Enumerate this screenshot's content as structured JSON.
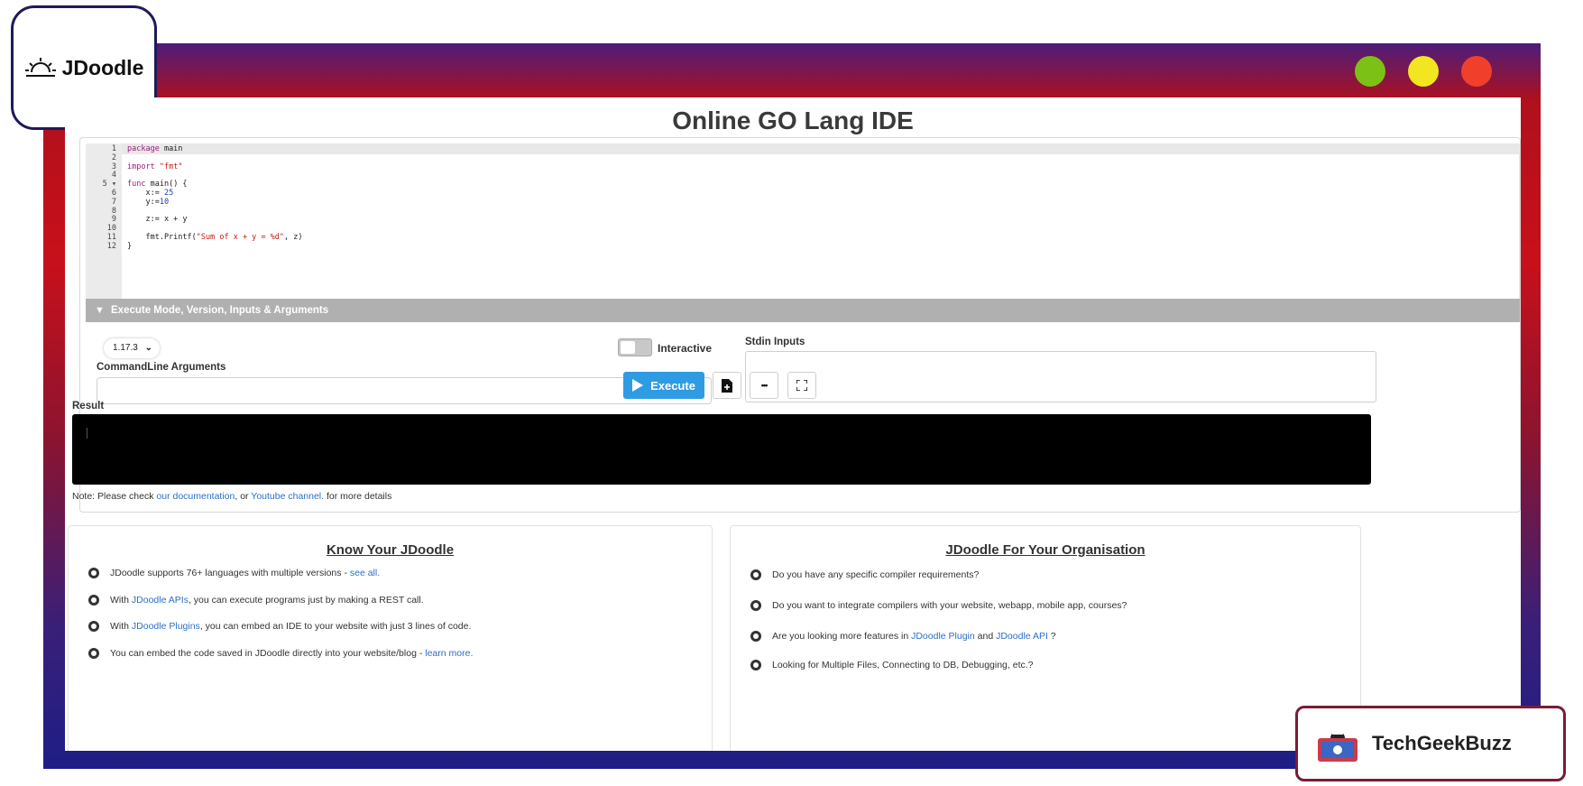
{
  "logo": {
    "text": "JDoodle",
    "icon": "sunrise-icon"
  },
  "window_controls": {
    "colors": [
      "#7cc115",
      "#f2e620",
      "#f0402b"
    ]
  },
  "page": {
    "title": "Online GO Lang IDE"
  },
  "editor": {
    "line_numbers": [
      "1",
      "2",
      "3",
      "4",
      "5",
      "6",
      "7",
      "8",
      "9",
      "10",
      "11",
      "12"
    ],
    "fold_marker": "▾",
    "code_lines": [
      "package main",
      "",
      "import \"fmt\"",
      "",
      "func main() {",
      "    x:= 25",
      "    y:=10",
      "",
      "    z:= x + y",
      "",
      "    fmt.Printf(\"Sum of x + y = %d\", z)",
      "}"
    ]
  },
  "execute_panel": {
    "header": "Execute Mode, Version, Inputs & Arguments",
    "version": "1.17.3",
    "interactive_label": "Interactive",
    "cmd_args_label": "CommandLine Arguments",
    "stdin_label": "Stdin Inputs"
  },
  "toolbar": {
    "execute_label": "Execute",
    "more_label": "•••"
  },
  "result": {
    "label": "Result"
  },
  "note": {
    "prefix": "Note: Please check ",
    "link1": "our documentation",
    "mid": ", or ",
    "link2": "Youtube channel.",
    "suffix": " for more details"
  },
  "cards": {
    "left": {
      "title": "Know Your JDoodle",
      "items": [
        {
          "text": "JDoodle supports 76+ languages with multiple versions - ",
          "link": "see all.",
          "after": ""
        },
        {
          "text": "With ",
          "link": "JDoodle APIs",
          "after": ", you can execute programs just by making a REST call."
        },
        {
          "text": "With ",
          "link": "JDoodle Plugins",
          "after": ", you can embed an IDE to your website with just 3 lines of code."
        },
        {
          "text": "You can embed the code saved in JDoodle directly into your website/blog - ",
          "link": "learn more.",
          "after": ""
        }
      ]
    },
    "right": {
      "title": "JDoodle For Your Organisation",
      "items": [
        {
          "text": "Do you have any specific compiler requirements?"
        },
        {
          "text": "Do you want to integrate compilers with your website, webapp, mobile app, courses?"
        },
        {
          "text": "Are you looking more features in ",
          "link": "JDoodle Plugin",
          "mid": " and ",
          "link2": "JDoodle API",
          "after": " ?"
        },
        {
          "text": "Looking for Multiple Files, Connecting to DB, Debugging, etc.?"
        }
      ]
    }
  },
  "watermark": {
    "text": "TechGeekBuzz"
  }
}
